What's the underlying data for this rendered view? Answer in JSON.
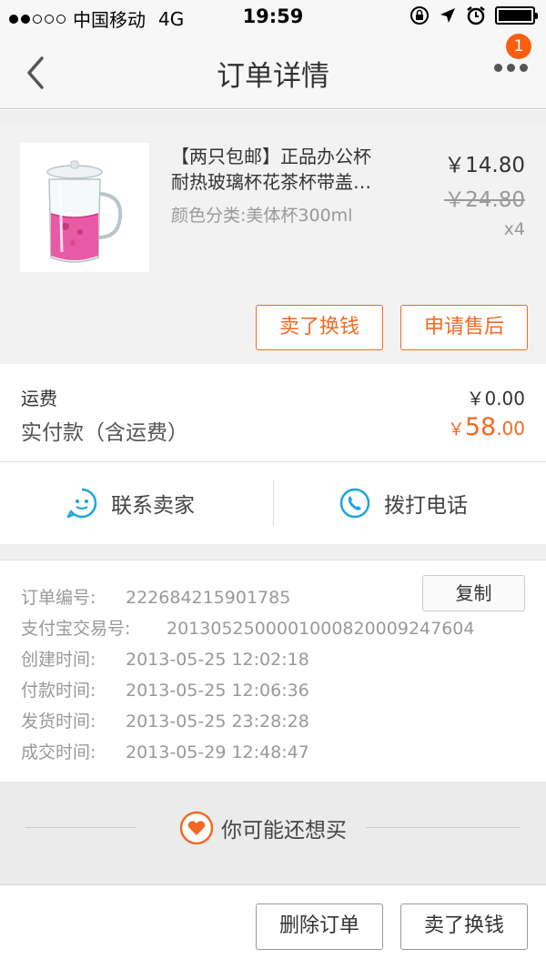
{
  "status_bar": {
    "carrier": "中国移动",
    "network": "4G",
    "time": "19:59"
  },
  "header": {
    "title": "订单详情",
    "badge_count": "1"
  },
  "product": {
    "name_line1": "【两只包邮】正品办公杯",
    "name_line2": "耐热玻璃杯花茶杯带盖…",
    "spec": "颜色分类:美体杯300ml",
    "price": "￥14.80",
    "original_price": "￥24.80",
    "quantity": "x4",
    "sell_button": "卖了换钱",
    "aftersale_button": "申请售后"
  },
  "payment": {
    "freight_label": "运费",
    "freight_value": "￥0.00",
    "total_label": "实付款（含运费）",
    "total_symbol": "￥",
    "total_int": "58",
    "total_dec": ".00"
  },
  "contact": {
    "seller_label": "联系卖家",
    "call_label": "拨打电话"
  },
  "order_info": {
    "copy_button": "复制",
    "rows": [
      {
        "key": "订单编号:",
        "value": "222684215901785"
      },
      {
        "key": "支付宝交易号:",
        "value": "2013052500001000820009247604"
      },
      {
        "key": "创建时间:",
        "value": "2013-05-25 12:02:18"
      },
      {
        "key": "付款时间:",
        "value": "2013-05-25 12:06:36"
      },
      {
        "key": "发货时间:",
        "value": "2013-05-25 23:28:28"
      },
      {
        "key": "成交时间:",
        "value": "2013-05-29 12:48:47"
      }
    ]
  },
  "recommend": {
    "label": "你可能还想买",
    "icon": "heart-icon"
  },
  "bottom_bar": {
    "delete_button": "删除订单",
    "sell_button": "卖了换钱"
  },
  "colors": {
    "accent": "#f26a21",
    "badge": "#f95f0f",
    "contact_icon": "#1fa3e0"
  }
}
